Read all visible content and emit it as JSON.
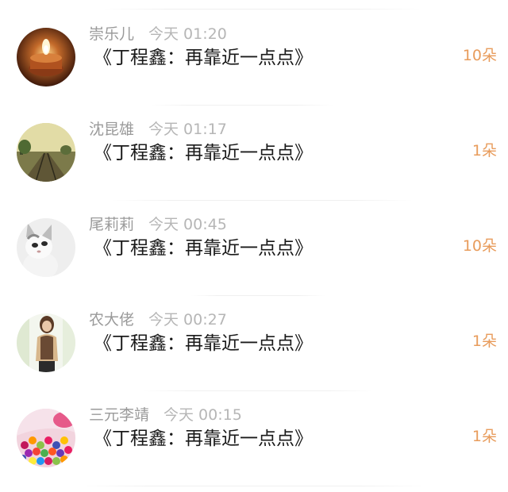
{
  "gifts": [
    {
      "name": "崇乐儿",
      "time": "今天 01:20",
      "title": "《丁程鑫：再靠近一点点》",
      "count": "10朵"
    },
    {
      "name": "沈昆雄",
      "time": "今天 01:17",
      "title": "《丁程鑫：再靠近一点点》",
      "count": "1朵"
    },
    {
      "name": "尾莉莉",
      "time": "今天 00:45",
      "title": "《丁程鑫：再靠近一点点》",
      "count": "10朵"
    },
    {
      "name": "农大佬",
      "time": "今天 00:27",
      "title": "《丁程鑫：再靠近一点点》",
      "count": "1朵"
    },
    {
      "name": "三元李靖",
      "time": "今天 00:15",
      "title": "《丁程鑫：再靠近一点点》",
      "count": "1朵"
    }
  ],
  "colors": {
    "name": "#9a9a9a",
    "time": "#b6b6b6",
    "title": "#1a1a1a",
    "count": "#e89c5c",
    "divider": "#f0f0f0"
  }
}
